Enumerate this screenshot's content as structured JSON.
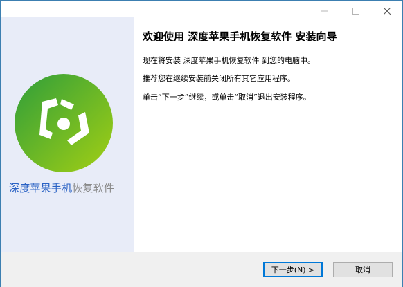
{
  "window": {
    "controls": {
      "minimize_icon": "minimize-icon",
      "maximize_icon": "maximize-icon",
      "close_icon": "close-icon"
    }
  },
  "sidebar": {
    "brand_part1": "深度苹果手机",
    "brand_part2": "恢复软件",
    "colors": {
      "background": "#e8ecf8",
      "brand_blue": "#2a62c4",
      "brand_gray": "#8a8a8a",
      "logo_green_dark": "#2f9e3a",
      "logo_green_light": "#9ccc1a"
    }
  },
  "content": {
    "heading": "欢迎使用  深度苹果手机恢复软件  安装向导",
    "paragraphs": [
      "现在将安装 深度苹果手机恢复软件 到您的电脑中。",
      "推荐您在继续安装前关闭所有其它应用程序。",
      "单击“下一步”继续，或单击“取消”退出安装程序。"
    ]
  },
  "footer": {
    "next_label": "下一步(N) >",
    "cancel_label": "取消"
  }
}
